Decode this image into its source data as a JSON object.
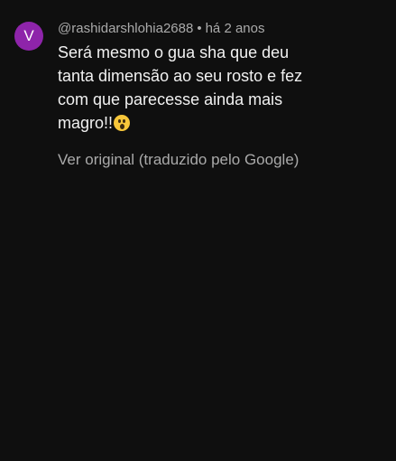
{
  "comment": {
    "avatar_letter": "V",
    "avatar_color": "#8e24aa",
    "username": "@rashidarshlohia2688",
    "separator": "•",
    "time_ago": "há 2 anos",
    "text": "Será mesmo o gua sha que deu tanta dimensão ao seu rosto e fez com que parecesse ainda mais magro!!",
    "emoji_icon": "hushed-face-icon",
    "translate_link": "Ver original (traduzido pelo Google)"
  }
}
